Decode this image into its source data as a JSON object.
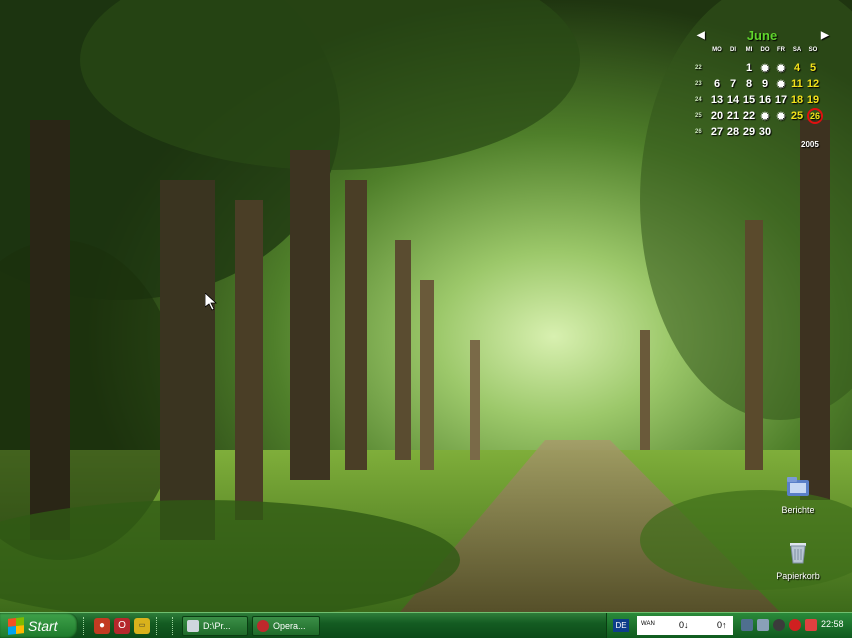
{
  "calendar": {
    "month": "June",
    "year": "2005",
    "weekday_headers": [
      "MO",
      "DI",
      "MI",
      "DO",
      "FR",
      "SA",
      "SO"
    ],
    "weeks": [
      {
        "wk": "22",
        "days": [
          "",
          "",
          "1",
          "✹",
          "✹",
          "4",
          "5"
        ]
      },
      {
        "wk": "23",
        "days": [
          "6",
          "7",
          "8",
          "9",
          "✹",
          "11",
          "12"
        ]
      },
      {
        "wk": "24",
        "days": [
          "13",
          "14",
          "15",
          "16",
          "17",
          "18",
          "19"
        ]
      },
      {
        "wk": "25",
        "days": [
          "20",
          "21",
          "22",
          "✹",
          "✹",
          "25",
          "26"
        ]
      },
      {
        "wk": "26",
        "days": [
          "27",
          "28",
          "29",
          "30",
          "",
          "",
          ""
        ]
      }
    ],
    "today": "26"
  },
  "desktop_icons": [
    {
      "label": "Berichte",
      "icon": "folder-berichte-icon"
    },
    {
      "label": "Papierkorb",
      "icon": "recycle-bin-icon"
    }
  ],
  "taskbar": {
    "start_label": "Start",
    "tasks": [
      {
        "label": "D:\\Pr...",
        "icon": "explorer-icon"
      },
      {
        "label": "Opera...",
        "icon": "opera-icon"
      }
    ],
    "language": "DE",
    "net_label": "WAN",
    "net_down": "0↓",
    "net_up": "0↑",
    "clock": "22:58"
  },
  "colors": {
    "taskbar": "#145c22",
    "calendar_month": "#5fd42c",
    "weekend": "#f2e11b",
    "today_ring": "#e01010"
  }
}
